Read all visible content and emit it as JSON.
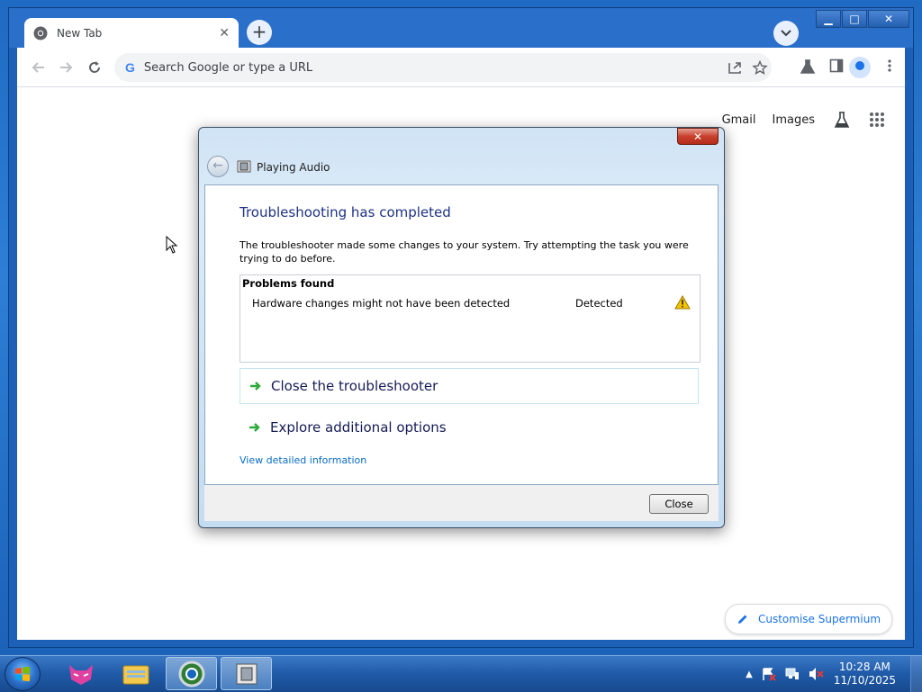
{
  "browser": {
    "tab_title": "New Tab",
    "tab_close": "✕",
    "new_tab_symbol": "+",
    "window_controls": {
      "minimize": "▁",
      "maximize": "□",
      "close": "✕"
    },
    "omnibox_placeholder": "Search Google or type a URL",
    "omnibox_icon": "G"
  },
  "newtab_page": {
    "links": [
      "Gmail",
      "Images"
    ],
    "customise_label": "Customise Supermium"
  },
  "dialog": {
    "title": "Playing Audio",
    "close_symbol": "✕",
    "heading": "Troubleshooting has completed",
    "description": "The troubleshooter made some changes to your system. Try attempting the task you were trying to do before.",
    "problems_header": "Problems found",
    "problems": [
      {
        "text": "Hardware changes might not have been detected",
        "status": "Detected",
        "icon": "warning-icon"
      }
    ],
    "options": [
      {
        "label": "Close the troubleshooter",
        "icon": "green-arrow-icon"
      },
      {
        "label": "Explore additional options",
        "icon": "green-arrow-icon"
      }
    ],
    "detail_link": "View detailed information",
    "close_button": "Close"
  },
  "taskbar": {
    "apps": [
      "cat-app-icon",
      "file-explorer-icon",
      "browser-icon",
      "troubleshooter-icon"
    ],
    "time": "10:28 AM",
    "date": "11/10/2025"
  },
  "colors": {
    "heading_blue": "#1e3287",
    "link_blue": "#0a6cc4",
    "accent": "#1a73e8",
    "arrow_green": "#2eaa3a",
    "warning_yellow": "#f5c400"
  }
}
